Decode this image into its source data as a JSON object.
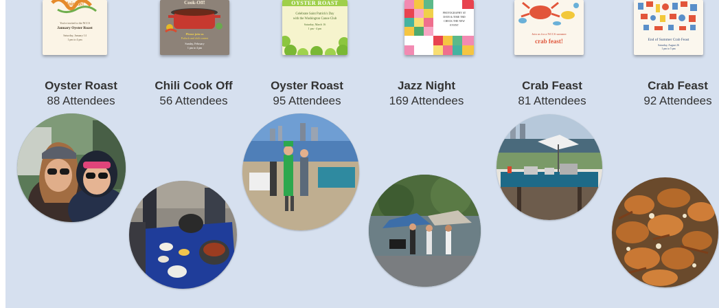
{
  "events": [
    {
      "name": "Oyster Roast",
      "attendees": "88 Attendees",
      "card": {
        "heading": "Join us!",
        "lines": [
          "You're invited to the NCCS",
          "January Oyster Roast",
          "Saturday, January 14",
          "1 pm to 4 pm"
        ]
      }
    },
    {
      "name": "Chili Cook Off",
      "attendees": "56 Attendees",
      "card": {
        "heading": "Cook-Off!",
        "lines": [
          "Please join us",
          "Potluck and chili contest",
          "Sunday, February",
          "1 pm to 4 pm"
        ]
      }
    },
    {
      "name": "Oyster Roast",
      "attendees": "95 Attendees",
      "card": {
        "heading": "OYSTER ROAST",
        "lines": [
          "Celebrate Saint Patrick's Day",
          "with the Washington Canoe Club",
          "Saturday, March 16",
          "1 pm - 4 pm"
        ]
      }
    },
    {
      "name": "Jazz Night",
      "attendees": "169 Attendees",
      "card": {
        "heading": "",
        "lines": [
          "PHOTOGRAPHY AT",
          "DATE & TIME TBD",
          "CHECK THE NEW",
          "EVENT"
        ]
      }
    },
    {
      "name": "Crab Feast",
      "attendees": "81 Attendees",
      "card": {
        "heading": "crab feast!",
        "lines": [
          "Join us for a NCCS summer"
        ]
      }
    },
    {
      "name": "Crab Feast",
      "attendees": "92 Attendees",
      "card": {
        "heading": "End of Summer Crab Feast",
        "lines": [
          "Saturday, August 26",
          "1 pm to 5 pm"
        ]
      }
    }
  ],
  "colors": {
    "slide_background": "#d6e0ef",
    "text": "#333333"
  }
}
